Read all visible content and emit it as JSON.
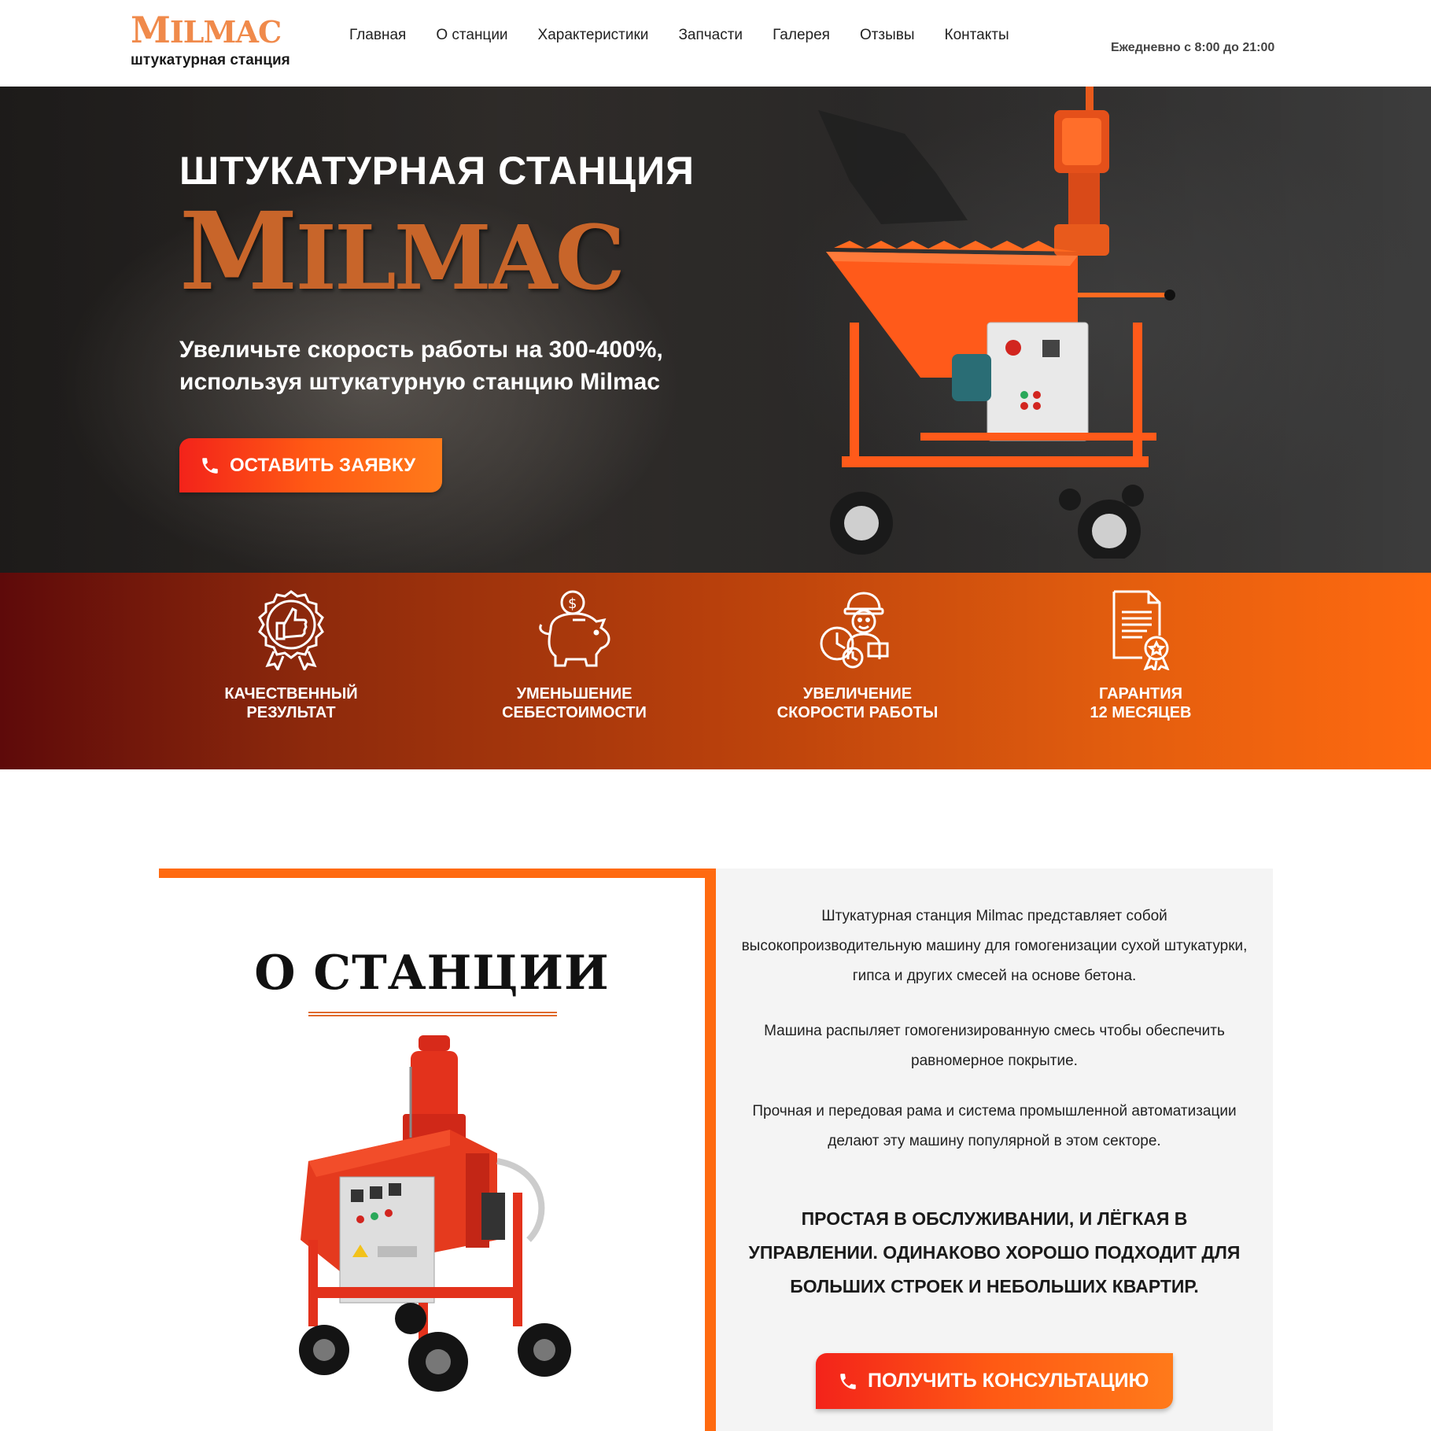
{
  "header": {
    "logo_word_big": "M",
    "logo_word_rest": "ILMAC",
    "logo_subtitle": "штукатурная станция",
    "nav": [
      "Главная",
      "О станции",
      "Характеристики",
      "Запчасти",
      "Галерея",
      "Отзывы",
      "Контакты"
    ],
    "hours": "Ежедневно с 8:00 до 21:00"
  },
  "hero": {
    "title": "ШТУКАТУРНАЯ СТАНЦИЯ",
    "brand_big": "M",
    "brand_rest": "ILMAC",
    "subtitle": "Увеличьте скорость работы на 300-400%, используя штукатурную станцию Milmac",
    "cta_label": "ОСТАВИТЬ ЗАЯВКУ"
  },
  "features": [
    {
      "icon": "thumbs-up-badge-icon",
      "line1": "КАЧЕСТВЕННЫЙ",
      "line2": "РЕЗУЛЬТАТ"
    },
    {
      "icon": "piggy-bank-icon",
      "line1": "УМЕНЬШЕНИЕ",
      "line2": "СЕБЕСТОИМОСТИ"
    },
    {
      "icon": "worker-speed-icon",
      "line1": "УВЕЛИЧЕНИЕ",
      "line2": "СКОРОСТИ РАБОТЫ"
    },
    {
      "icon": "certificate-icon",
      "line1": "ГАРАНТИЯ",
      "line2": "12 МЕСЯЦЕВ"
    }
  ],
  "about": {
    "title": "О СТАНЦИИ",
    "p1": "Штукатурная станция Milmac представляет собой высокопроизводительную машину для гомогенизации сухой штукатурки, гипса и других смесей на основе бетона.",
    "p2": "Машина распыляет гомогенизированную смесь чтобы обеспечить равномерное покрытие.",
    "p3": "Прочная и передовая рама и система промышленной автоматизации делают эту машину популярной в этом секторе.",
    "highlight": "ПРОСТАЯ В ОБСЛУЖИВАНИИ, И ЛЁГКАЯ В УПРАВЛЕНИИ. ОДИНАКОВО ХОРОШО ПОДХОДИТ ДЛЯ БОЛЬШИХ СТРОЕК И НЕБОЛЬШИХ КВАРТИР.",
    "cta_label": "ПОЛУЧИТЬ КОНСУЛЬТАЦИЮ"
  },
  "colors": {
    "accent": "#ff6a10",
    "brand": "#c8652a",
    "logo": "#f08a4b",
    "button_start": "#f3231a",
    "button_end": "#ff7a1a"
  }
}
